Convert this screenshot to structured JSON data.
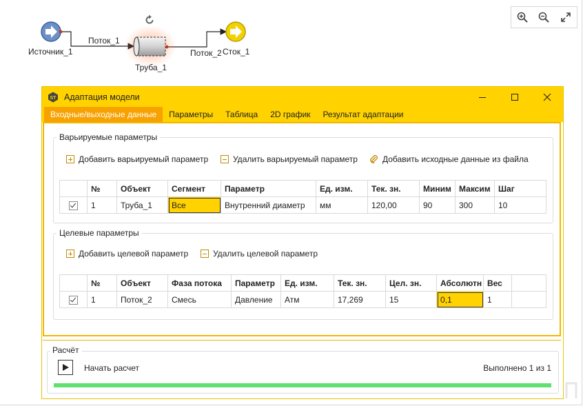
{
  "diagram": {
    "nodes": {
      "source": "Источник_1",
      "flow1": "Поток_1",
      "pipe": "Труба_1",
      "flow2": "Поток_2",
      "sink": "Сток_1"
    }
  },
  "zoom": {
    "icons": [
      "zoom-in-icon",
      "zoom-out-icon",
      "expand-icon"
    ]
  },
  "window": {
    "title": "Адаптация модели",
    "tabs": [
      "Входные/выходные данные",
      "Параметры",
      "Таблица",
      "2D график",
      "Результат адаптации"
    ],
    "active_tab": 0
  },
  "varied": {
    "group_title": "Варьируемые параметры",
    "add_label": "Добавить варьируемый параметр",
    "remove_label": "Удалить варьируемый параметр",
    "add_file_label": "Добавить исходные данные из файла",
    "columns": [
      "",
      "№",
      "Объект",
      "Сегмент",
      "Параметр",
      "Ед. изм.",
      "Тек. зн.",
      "Миним",
      "Максим",
      "Шаг"
    ],
    "rows": [
      {
        "checked": true,
        "num": "1",
        "object": "Труба_1",
        "segment": "Все",
        "param": "Внутренний диаметр",
        "unit": "мм",
        "current": "120,00",
        "min": "90",
        "max": "300",
        "step": "10"
      }
    ]
  },
  "target": {
    "group_title": "Целевые параметры",
    "add_label": "Добавить целевой параметр",
    "remove_label": "Удалить целевой параметр",
    "columns": [
      "",
      "№",
      "Объект",
      "Фаза потока",
      "Параметр",
      "Ед. изм.",
      "Тек. зн.",
      "Цел. зн.",
      "Абсолютн",
      "Вес"
    ],
    "rows": [
      {
        "checked": true,
        "num": "1",
        "object": "Поток_2",
        "phase": "Смесь",
        "param": "Давление",
        "unit": "Атм",
        "current": "17,269",
        "target": "15",
        "absolute": "0,1",
        "weight": "1"
      }
    ]
  },
  "calc": {
    "group_title": "Расчёт",
    "start_label": "Начать расчет",
    "status": "Выполнено 1 из 1",
    "progress": 1.0
  },
  "colors": {
    "accent": "#ffd200",
    "active_tab": "#f7a200",
    "progress": "#5fe06f"
  }
}
